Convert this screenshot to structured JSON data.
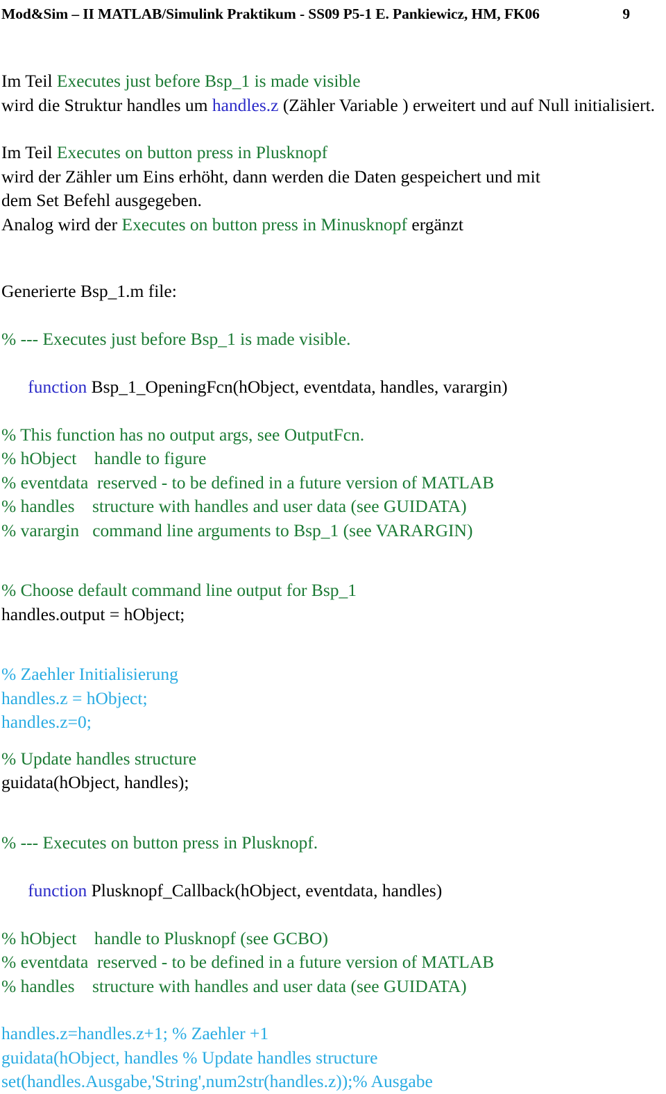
{
  "header": {
    "title": "Mod&Sim – II MATLAB/Simulink Praktikum - SS09 P5-1 E. Pankiewicz, HM, FK06",
    "page_number": "9"
  },
  "colors": {
    "comment_green": "#1b7a34",
    "keyword_blue": "#2a2ac8",
    "highlight_cyan": "#29abe2",
    "body_black": "#000000"
  },
  "paragraphs": {
    "p1": {
      "line1_prefix": "Im Teil ",
      "line1_green": "Executes just before Bsp_1 is made visible",
      "line2_prefix": "wird die Struktur handles um ",
      "line2_blue": "handles.z",
      "line2_suffix": " (Zähler Variable ) erweitert und auf Null initialisiert."
    },
    "p2": {
      "line1_prefix": "Im Teil ",
      "line1_green": "Executes on button press in Plusknopf",
      "line2": "wird der Zähler um Eins erhöht, dann werden die Daten gespeichert und mit",
      "line3": "dem Set Befehl ausgegeben.",
      "line4_prefix": "Analog wird der ",
      "line4_green": "Executes on button press in Minusknopf",
      "line4_suffix": " ergänzt"
    }
  },
  "file_heading": "Generierte Bsp_1.m  file:",
  "code": {
    "block1": {
      "l1_green": "% --- Executes just before Bsp_1 is made visible.",
      "l2_keyword": "function",
      "l2_rest": " Bsp_1_OpeningFcn(hObject, eventdata, handles, varargin)",
      "l3_green": "% This function has no output args, see OutputFcn.",
      "l4_green": "% hObject    handle to figure",
      "l5_green": "% eventdata  reserved - to be defined in a future version of MATLAB",
      "l6_green": "% handles    structure with handles and user data (see GUIDATA)",
      "l7_green": "% varargin   command line arguments to Bsp_1 (see VARARGIN)"
    },
    "block2": {
      "l1_green": "% Choose default command line output for Bsp_1",
      "l2_black": "handles.output = hObject;"
    },
    "block3": {
      "l1_cyan": "% Zaehler Initialisierung",
      "l2_cyan": "handles.z = hObject;",
      "l3_cyan": "handles.z=0;"
    },
    "block4": {
      "l1_green": "% Update handles structure",
      "l2_black": "guidata(hObject, handles);"
    },
    "block5": {
      "l1_green": "% --- Executes on button press in Plusknopf.",
      "l2_keyword": "function",
      "l2_rest": " Plusknopf_Callback(hObject, eventdata, handles)",
      "l3_green": "% hObject    handle to Plusknopf (see GCBO)",
      "l4_green": "% eventdata  reserved - to be defined in a future version of MATLAB",
      "l5_green": "% handles    structure with handles and user data (see GUIDATA)"
    },
    "block6": {
      "l1_cyan": "handles.z=handles.z+1; % Zaehler +1",
      "l2_cyan": "guidata(hObject, handles % Update handles structure",
      "l3_cyan": "set(handles.Ausgabe,'String',num2str(handles.z));% Ausgabe"
    }
  }
}
